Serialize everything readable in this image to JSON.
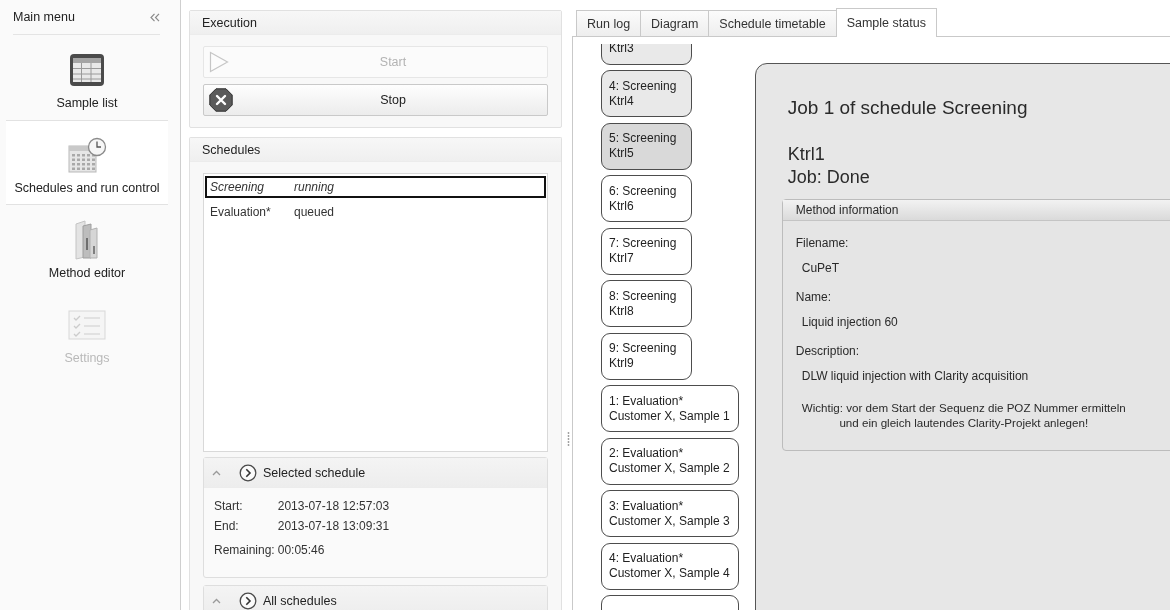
{
  "sidebar": {
    "title": "Main menu",
    "items": [
      {
        "kind": "table",
        "label": "Sample list",
        "selected": false,
        "disabled": false
      },
      {
        "kind": "calendar",
        "label": "Schedules and run control",
        "selected": true,
        "disabled": false
      },
      {
        "kind": "binder",
        "label": "Method editor",
        "selected": false,
        "disabled": false
      },
      {
        "kind": "checklist",
        "label": "Settings",
        "selected": false,
        "disabled": true
      }
    ]
  },
  "execution": {
    "title": "Execution",
    "buttons": [
      {
        "kind": "start",
        "label": "Start",
        "disabled": true
      },
      {
        "kind": "stop",
        "label": "Stop",
        "disabled": false
      }
    ]
  },
  "schedules": {
    "title": "Schedules",
    "rows": [
      {
        "name": "Screening",
        "status": "running",
        "selected": true,
        "active": true
      },
      {
        "name": "Evaluation*",
        "status": "queued",
        "selected": false,
        "active": false
      }
    ],
    "sections": [
      {
        "title": "Selected schedule",
        "expanded": true,
        "fields": [
          {
            "label": "Start:",
            "value": "2013-07-18 12:57:03"
          },
          {
            "label": "End:",
            "value": "2013-07-18 13:09:31"
          },
          {
            "label": "Remaining:",
            "value": "00:05:46"
          }
        ]
      },
      {
        "title": "All schedules",
        "expanded": true
      }
    ]
  },
  "tabs": [
    {
      "label": "Run log",
      "selected": false
    },
    {
      "label": "Diagram",
      "selected": false
    },
    {
      "label": "Schedule timetable",
      "selected": false
    },
    {
      "label": "Sample status",
      "selected": true
    }
  ],
  "job_groups": [
    {
      "jobs": [
        {
          "sample": "Ktrl3",
          "done": true,
          "active": false
        },
        {
          "title": "4: Screening",
          "sample": "Ktrl4",
          "done": true,
          "active": false
        },
        {
          "title": "5: Screening",
          "sample": "Ktrl5",
          "done": false,
          "active": true
        },
        {
          "title": "6: Screening",
          "sample": "Ktrl6",
          "done": false,
          "active": false
        },
        {
          "title": "7: Screening",
          "sample": "Ktrl7",
          "done": false,
          "active": false
        },
        {
          "title": "8: Screening",
          "sample": "Ktrl8",
          "done": false,
          "active": false
        },
        {
          "title": "9: Screening",
          "sample": "Ktrl9",
          "done": false,
          "active": false
        }
      ]
    },
    {
      "jobs": [
        {
          "title": "1: Evaluation*",
          "sample": "Customer X, Sample 1",
          "done": false,
          "active": false
        },
        {
          "title": "2: Evaluation*",
          "sample": "Customer X, Sample 2",
          "done": false,
          "active": false
        },
        {
          "title": "3: Evaluation*",
          "sample": "Customer X, Sample 3",
          "done": false,
          "active": false
        },
        {
          "title": "4: Evaluation*",
          "sample": "Customer X, Sample 4",
          "done": false,
          "active": false
        },
        {
          "done": false,
          "active": false
        }
      ]
    }
  ],
  "detail": {
    "title": "Job 1 of schedule Screening",
    "sample": "Ktrl1",
    "job_status": "Job: Done",
    "method": {
      "title": "Method information",
      "fields": [
        {
          "label": "Filename:",
          "value": "CuPeT"
        },
        {
          "label": "Name:",
          "value": "Liquid injection 60"
        },
        {
          "label": "Description:",
          "value": "DLW liquid injection with Clarity acquisition"
        }
      ],
      "note": "Wichtig: vor dem Start der Sequenz die POZ Nummer ermitteln\nund ein gleich lautendes Clarity-Projekt anlegen!"
    }
  }
}
